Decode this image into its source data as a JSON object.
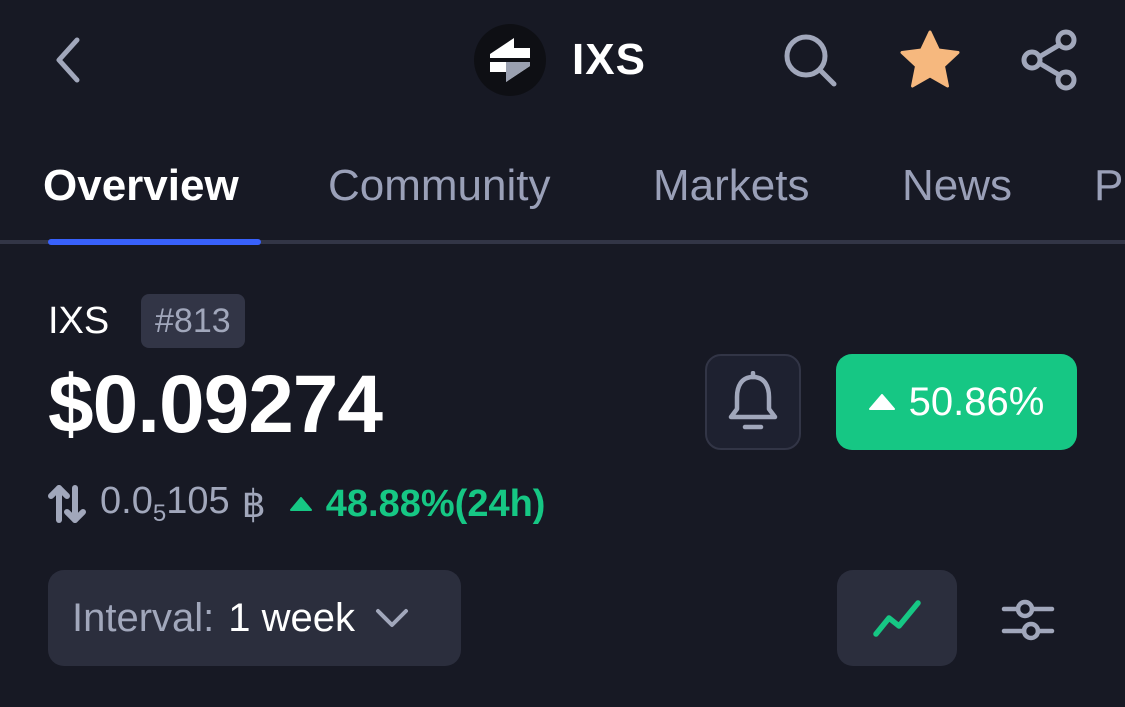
{
  "header": {
    "title": "IXS",
    "icons": {
      "back": "chevron-left-icon",
      "logo": "ixs-logo",
      "search": "search-icon",
      "favorite": "star-icon",
      "share": "share-icon"
    },
    "favorite_color": "#F6B87E"
  },
  "tabs": [
    {
      "label": "Overview",
      "active": true
    },
    {
      "label": "Community",
      "active": false
    },
    {
      "label": "Markets",
      "active": false
    },
    {
      "label": "News",
      "active": false
    },
    {
      "label": "P",
      "active": false
    }
  ],
  "coin": {
    "symbol": "IXS",
    "rank": "#813",
    "price": "$0.09274",
    "price_change_badge": "50.86%",
    "btc_price": {
      "prefix": "0.0",
      "subscript_zeros": "5",
      "digits": "105",
      "unit": "฿"
    },
    "btc_change": "48.88%(24h)",
    "icons": {
      "alert": "bell-icon",
      "swap": "swap-vertical-icon",
      "up": "triangle-up-icon"
    }
  },
  "controls": {
    "interval_label": "Interval:",
    "interval_value": "1 week",
    "icons": {
      "dropdown": "chevron-down-icon",
      "chart": "line-chart-icon",
      "settings": "sliders-icon"
    }
  },
  "colors": {
    "background": "#171924",
    "accent": "#3861FB",
    "positive": "#16C784",
    "muted_text": "#A1A7BB",
    "surface": "#2B2E3D"
  }
}
